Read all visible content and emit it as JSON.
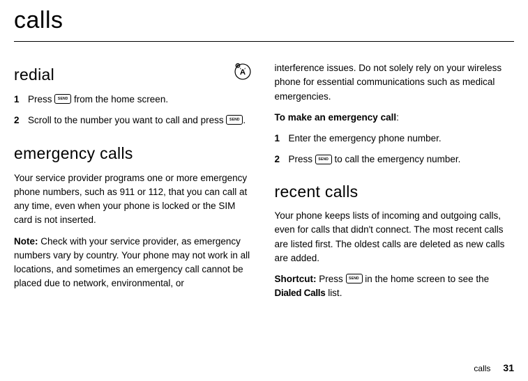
{
  "page": {
    "title": "calls",
    "footer_label": "calls",
    "footer_page": "31"
  },
  "keys": {
    "send": "SEND"
  },
  "left": {
    "redial": {
      "heading": "redial",
      "step1_num": "1",
      "step1_a": "Press ",
      "step1_b": " from the home screen.",
      "step2_num": "2",
      "step2_a": "Scroll to the number you want to call and press ",
      "step2_b": "."
    },
    "emergency": {
      "heading": "emergency calls",
      "para1": "Your service provider programs one or more emergency phone numbers, such as 911 or 112, that you can call at any time, even when your phone is locked or the SIM card is not inserted.",
      "note_label": "Note:",
      "note_text": " Check with your service provider, as emergency numbers vary by country. Your phone may not work in all locations, and sometimes an emergency call cannot be placed due to network, environmental, or"
    }
  },
  "right": {
    "cont": "interference issues. Do not solely rely on your wireless phone for essential communications such as medical emergencies.",
    "make_label": "To make an emergency call",
    "make_colon": ":",
    "step1_num": "1",
    "step1": "Enter the emergency phone number.",
    "step2_num": "2",
    "step2_a": "Press ",
    "step2_b": " to call the emergency number.",
    "recent": {
      "heading": "recent calls",
      "para1": "Your phone keeps lists of incoming and outgoing calls, even for calls that didn't connect. The most recent calls are listed first. The oldest calls are deleted as new calls are added.",
      "shortcut_label": "Shortcut:",
      "shortcut_a": " Press ",
      "shortcut_b": " in the home screen to see the ",
      "shortcut_list": "Dialed Calls",
      "shortcut_c": " list."
    }
  }
}
